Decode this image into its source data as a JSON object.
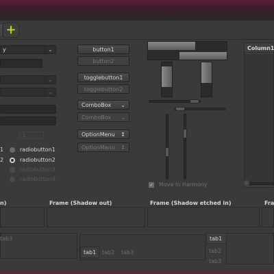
{
  "toolbar": {
    "add_icon": "plus-icon",
    "add_color": "#b6d62a"
  },
  "combos": {
    "combo1_text": "y",
    "combo_down": "⌄"
  },
  "buttons": {
    "button1": "button1",
    "button2": "button2",
    "toggle1": "togglebutton1",
    "toggle2": "togglebutton2",
    "combobox1": "ComboBox",
    "combobox2": "ComboBox",
    "optionmenu1": "OptionMenu",
    "optionmenu2": "OptionMenu",
    "chevron": "⌄",
    "updown": "↕"
  },
  "spin": {
    "value": "1"
  },
  "radios": {
    "left_r1": "1",
    "left_r2": "2",
    "r1": "radiobutton1",
    "r2": "radiobutton2",
    "r3": "radiobutton3",
    "r4": "radiobutton4"
  },
  "checkbox": {
    "label": "Move In Harmony",
    "checked": true
  },
  "tree": {
    "column1": "Column1"
  },
  "frames": {
    "f0": "n)",
    "f1": "Frame (Shadow out)",
    "f2": "Frame (Shadow etched in)",
    "f3": "Fra"
  },
  "tabs": {
    "left_tab3": "tab3",
    "mid": [
      "tab1",
      "tab2",
      "tab3"
    ],
    "right": [
      "tab1",
      "tab2",
      "tab3"
    ]
  }
}
